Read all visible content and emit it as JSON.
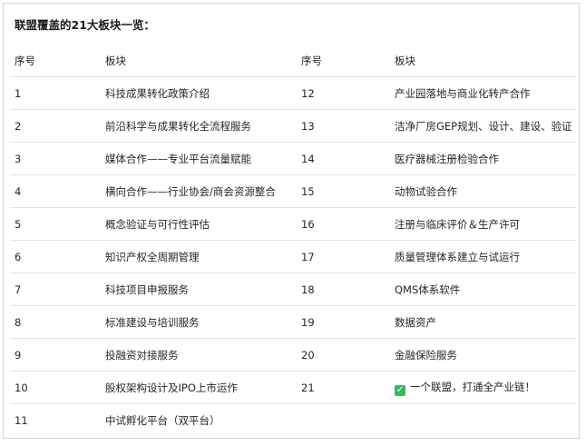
{
  "title": "联盟覆盖的21大板块一览：",
  "headers": [
    "序号",
    "板块",
    "序号",
    "板块"
  ],
  "rows": [
    {
      "left_no": "1",
      "left_name": "科技成果转化政策介绍",
      "right_no": "12",
      "right_name": "产业园落地与商业化转产合作"
    },
    {
      "left_no": "2",
      "left_name": "前沿科学与成果转化全流程服务",
      "right_no": "13",
      "right_name": "洁净厂房GEP规划、设计、建设、验证"
    },
    {
      "left_no": "3",
      "left_name": "媒体合作——专业平台流量赋能",
      "right_no": "14",
      "right_name": "医疗器械注册检验合作"
    },
    {
      "left_no": "4",
      "left_name": "横向合作——行业协会/商会资源整合",
      "right_no": "15",
      "right_name": "动物试验合作"
    },
    {
      "left_no": "5",
      "left_name": "概念验证与可行性评估",
      "right_no": "16",
      "right_name": "注册与临床评价＆生产许可"
    },
    {
      "left_no": "6",
      "left_name": "知识产权全周期管理",
      "right_no": "17",
      "right_name": "质量管理体系建立与试运行"
    },
    {
      "left_no": "7",
      "left_name": "科技项目申报服务",
      "right_no": "18",
      "right_name": "QMS体系软件"
    },
    {
      "left_no": "8",
      "left_name": "标准建设与培训服务",
      "right_no": "19",
      "right_name": "数据资产"
    },
    {
      "left_no": "9",
      "left_name": "投融资对接服务",
      "right_no": "20",
      "right_name": "金融保险服务"
    },
    {
      "left_no": "10",
      "left_name": "股权架构设计及IPO上市运作",
      "right_no": "21",
      "right_name": "一个联盟，打通全产业链！"
    },
    {
      "left_no": "11",
      "left_name": "中试孵化平台（双平台）",
      "right_no": "",
      "right_name": ""
    }
  ],
  "icons": {
    "row_21": "check-mark-icon"
  },
  "colors": {
    "check_icon": "#3fb56a",
    "divider": "#e4e4e4"
  }
}
